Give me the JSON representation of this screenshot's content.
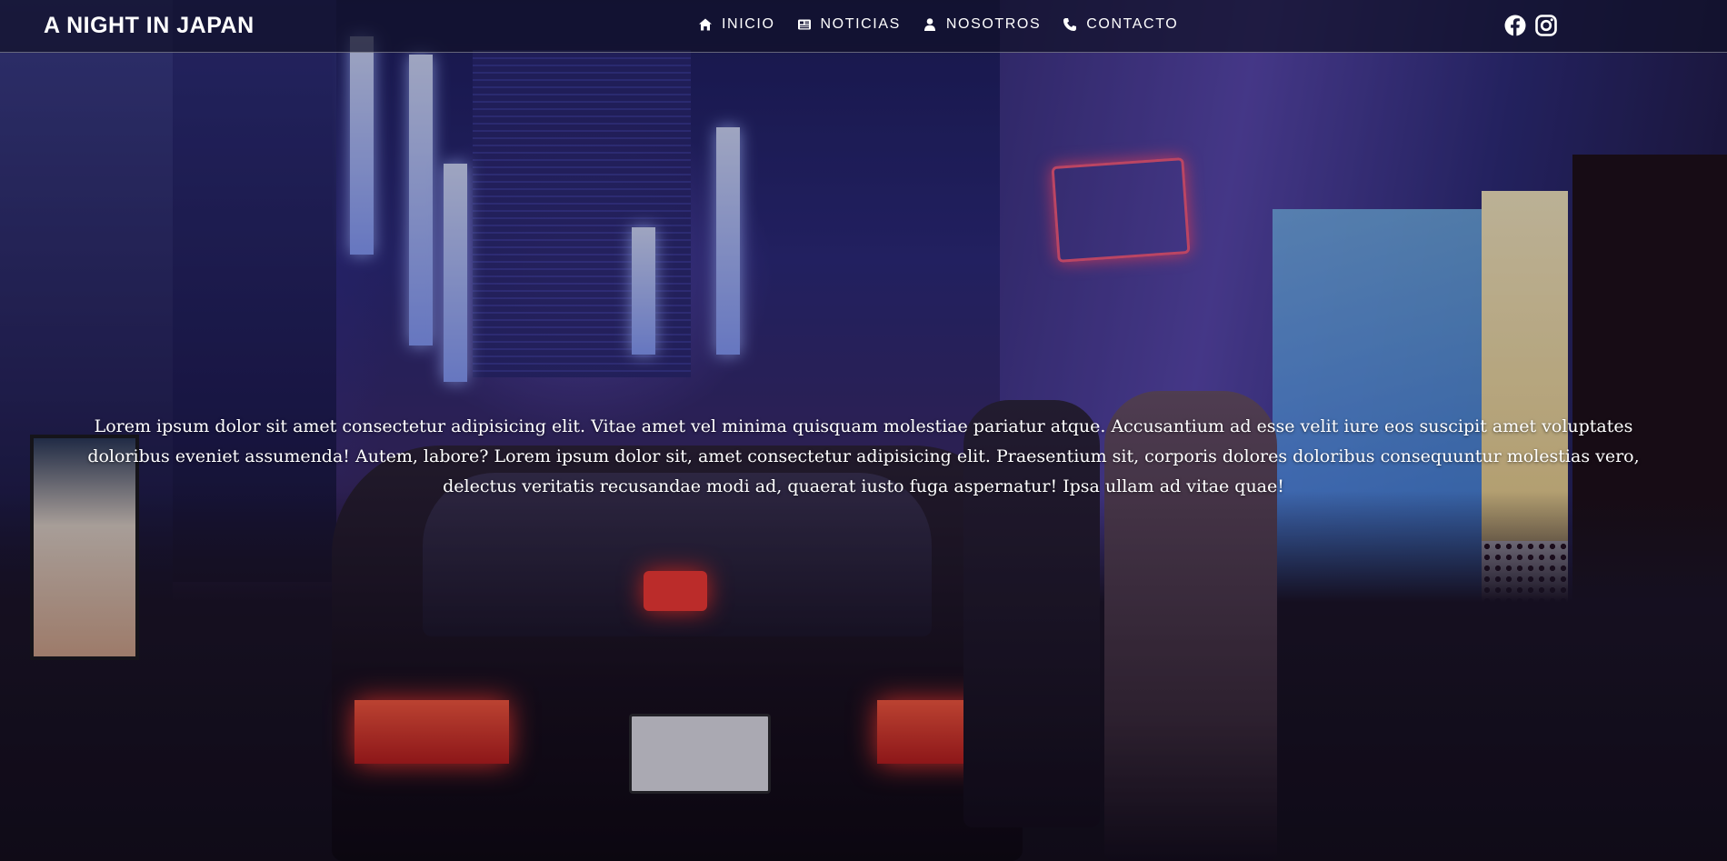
{
  "brand": {
    "title": "A NIGHT IN JAPAN"
  },
  "nav": {
    "items": [
      {
        "label": "INICIO",
        "icon": "home-icon"
      },
      {
        "label": "NOTICIAS",
        "icon": "newspaper-icon"
      },
      {
        "label": "NOSOTROS",
        "icon": "user-icon"
      },
      {
        "label": "CONTACTO",
        "icon": "phone-icon"
      }
    ]
  },
  "social": {
    "icons": [
      "facebook-icon",
      "instagram-icon"
    ]
  },
  "hero": {
    "text": "Lorem ipsum dolor sit amet consectetur adipisicing elit. Vitae amet vel minima quisquam molestiae pariatur atque. Accusantium ad esse velit iure eos suscipit amet voluptates doloribus eveniet assumenda! Autem, labore? Lorem ipsum dolor sit, amet consectetur adipisicing elit. Praesentium sit, corporis dolores doloribus consequuntur molestias vero, delectus veritatis recusandae modi ad, quaerat iusto fuga aspernatur! Ipsa ullam ad vitae quae!"
  },
  "colors": {
    "text": "#ffffff",
    "navbar_bg": "#101028"
  }
}
